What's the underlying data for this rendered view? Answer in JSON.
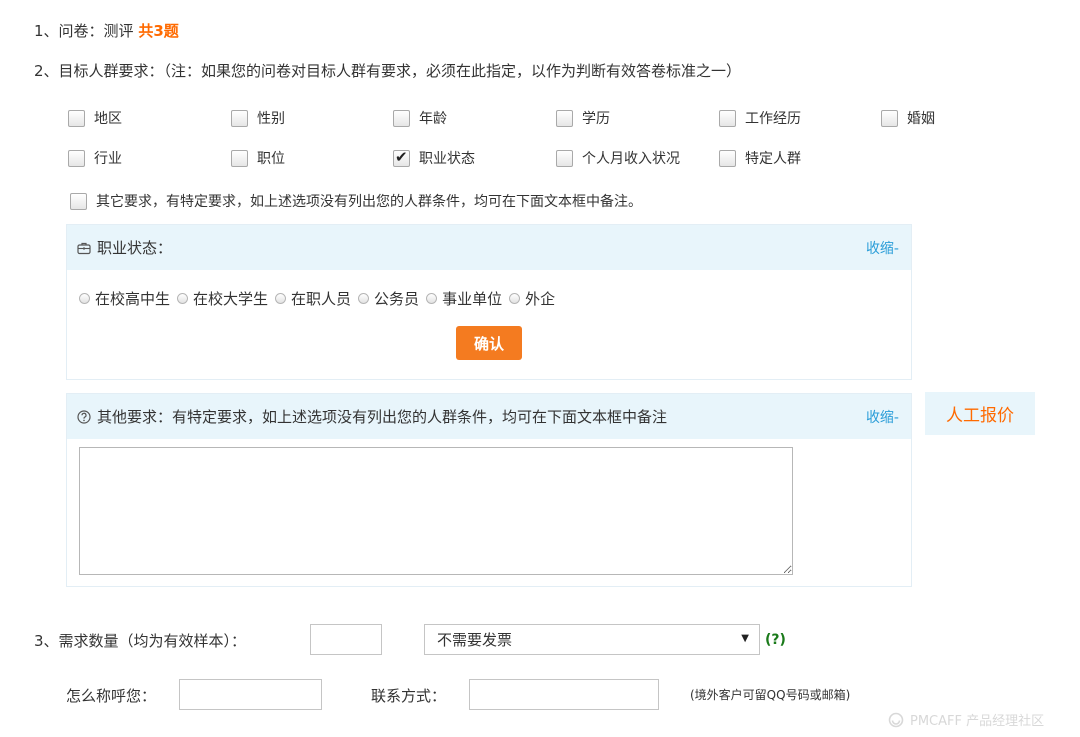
{
  "q1": {
    "prefix": "1、问卷：测评 ",
    "total": "共3题"
  },
  "q2": {
    "label": "2、目标人群要求：（注：如果您的问卷对目标人群有要求，必须在此指定，以作为判断有效答卷标准之一）"
  },
  "criteria": [
    {
      "label": "地区",
      "checked": false
    },
    {
      "label": "性别",
      "checked": false
    },
    {
      "label": "年龄",
      "checked": false
    },
    {
      "label": "学历",
      "checked": false
    },
    {
      "label": "工作经历",
      "checked": false
    },
    {
      "label": "婚姻",
      "checked": false
    },
    {
      "label": "行业",
      "checked": false
    },
    {
      "label": "职位",
      "checked": false
    },
    {
      "label": "职业状态",
      "checked": true
    },
    {
      "label": "个人月收入状况",
      "checked": false
    },
    {
      "label": "特定人群",
      "checked": false
    }
  ],
  "other_requirement_label": "其它要求，有特定要求，如上述选项没有列出您的人群条件，均可在下面文本框中备注。",
  "occupation_panel": {
    "title": "职业状态：",
    "collapse": "收缩-",
    "options": [
      "在校高中生",
      "在校大学生",
      "在职人员",
      "公务员",
      "事业单位",
      "外企"
    ],
    "confirm": "确认"
  },
  "other_panel": {
    "title": "其他要求：有特定要求，如上述选项没有列出您的人群条件，均可在下面文本框中备注",
    "collapse": "收缩-",
    "notes_value": ""
  },
  "manual_quote": "人工报价",
  "q3": {
    "label": "3、需求数量（均为有效样本）：",
    "quantity_value": "",
    "invoice_selected": "不需要发票",
    "help": "(?)"
  },
  "contact": {
    "name_label": "怎么称呼您：",
    "name_value": "",
    "contact_label": "联系方式：",
    "contact_value": "",
    "hint": "(境外客户可留QQ号码或邮箱)"
  },
  "watermark": "PMCAFF 产品经理社区",
  "colors": {
    "accent": "#ff6a00",
    "button": "#f47b20",
    "link": "#2a9dd8",
    "panel_bg": "#e8f5fb"
  }
}
